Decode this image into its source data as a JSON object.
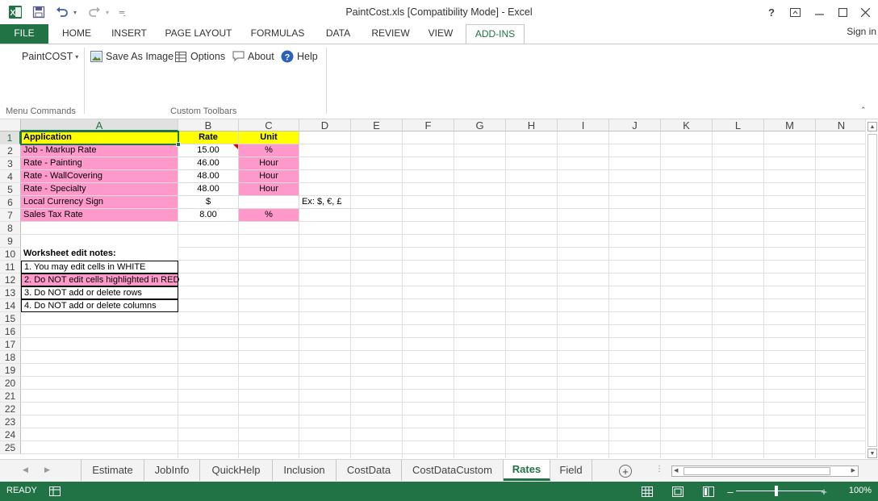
{
  "window": {
    "title": "PaintCost.xls  [Compatibility Mode] - Excel",
    "help_label": "?",
    "sign_in": "Sign in"
  },
  "quick_access": {
    "app_icon": "excel-icon",
    "save_icon": "save-icon",
    "undo_icon": "undo-icon",
    "redo_icon": "redo-icon",
    "customize_icon": "customize-icon"
  },
  "ribbon_tabs": [
    {
      "label": "FILE"
    },
    {
      "label": "HOME"
    },
    {
      "label": "INSERT"
    },
    {
      "label": "PAGE LAYOUT"
    },
    {
      "label": "FORMULAS"
    },
    {
      "label": "DATA"
    },
    {
      "label": "REVIEW"
    },
    {
      "label": "VIEW"
    },
    {
      "label": "ADD-INS"
    }
  ],
  "ribbon": {
    "menu": {
      "label": "PaintCOST",
      "group_label": "Menu Commands"
    },
    "toolbar": {
      "group_label": "Custom Toolbars",
      "items": [
        {
          "label": "Save As Image",
          "icon": "image-icon"
        },
        {
          "label": "Options",
          "icon": "table-icon"
        },
        {
          "label": "About",
          "icon": "speech-bubble-icon"
        },
        {
          "label": "Help",
          "icon": "help-icon"
        }
      ]
    }
  },
  "sheet": {
    "columns": [
      "A",
      "B",
      "C",
      "D",
      "E",
      "F",
      "G",
      "H",
      "I",
      "J",
      "K",
      "L",
      "M",
      "N"
    ],
    "rows": [
      "1",
      "2",
      "3",
      "4",
      "5",
      "6",
      "7",
      "8",
      "9",
      "10",
      "11",
      "12",
      "13",
      "14",
      "15",
      "16",
      "17",
      "18",
      "19",
      "20",
      "21",
      "22",
      "23",
      "24",
      "25"
    ],
    "header": {
      "application": "Application",
      "rate": "Rate",
      "unit": "Unit"
    },
    "rates": [
      {
        "application": "Job - Markup Rate",
        "rate": "15.00",
        "unit": "%"
      },
      {
        "application": "Rate - Painting",
        "rate": "46.00",
        "unit": "Hour"
      },
      {
        "application": "Rate - WallCovering",
        "rate": "48.00",
        "unit": "Hour"
      },
      {
        "application": "Rate - Specialty",
        "rate": "48.00",
        "unit": "Hour"
      },
      {
        "application": "Local Currency Sign",
        "rate": "$",
        "unit": ""
      },
      {
        "application": "Sales Tax Rate",
        "rate": "8.00",
        "unit": "%"
      }
    ],
    "currency_example": "Ex: $, €, £",
    "notes_title": "Worksheet edit notes:",
    "notes": [
      "1. You may edit cells in WHITE",
      "2. Do NOT edit cells highlighted in RED",
      "3. Do NOT add or delete rows",
      "4. Do NOT add or delete columns"
    ]
  },
  "sheet_tabs": [
    {
      "label": "Estimate"
    },
    {
      "label": "JobInfo"
    },
    {
      "label": "QuickHelp"
    },
    {
      "label": "Inclusion"
    },
    {
      "label": "CostData"
    },
    {
      "label": "CostDataCustom"
    },
    {
      "label": "Rates"
    },
    {
      "label": "Field"
    }
  ],
  "active_sheet": "Rates",
  "status": {
    "text": "READY",
    "zoom": "100%",
    "zoom_minus": "–",
    "zoom_plus": "+"
  },
  "colors": {
    "accent": "#217346",
    "header_yellow": "#ffff00",
    "locked_pink": "#ff99cc"
  }
}
